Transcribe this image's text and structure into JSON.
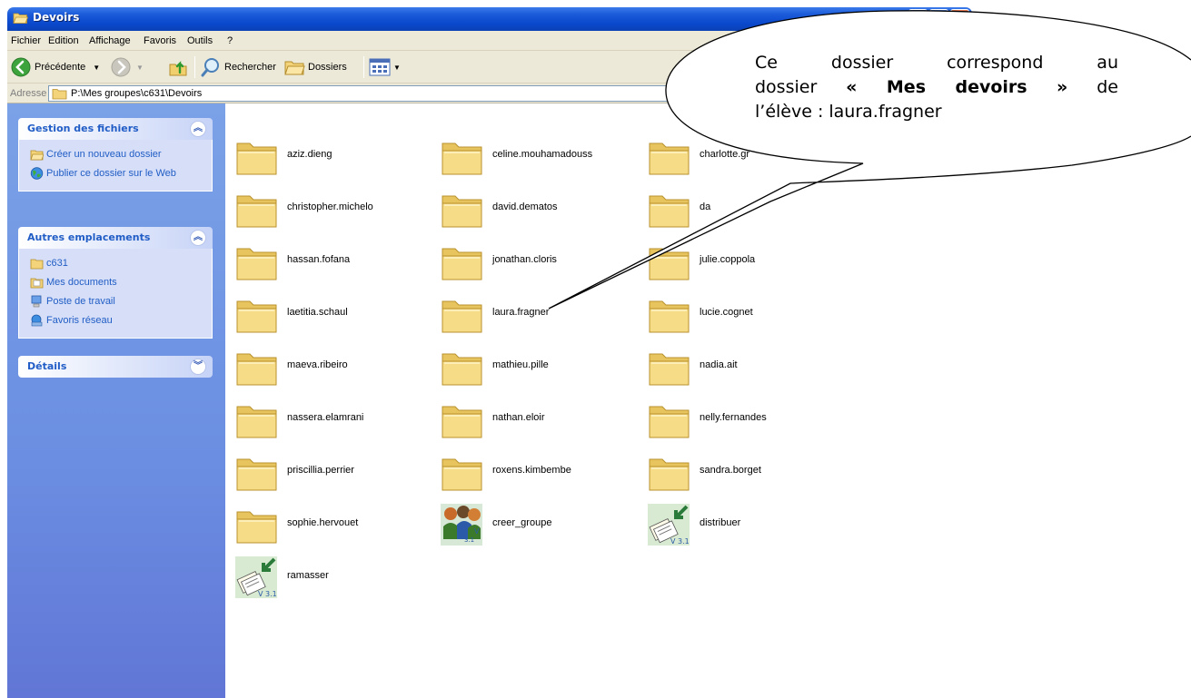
{
  "window": {
    "title": "Devoirs"
  },
  "menu": [
    "Fichier",
    "Edition",
    "Affichage",
    "Favoris",
    "Outils",
    "?"
  ],
  "toolbar": {
    "back_label": "Précédente",
    "search_label": "Rechercher",
    "folders_label": "Dossiers"
  },
  "address": {
    "label": "Adresse",
    "value": "P:\\Mes groupes\\c631\\Devoirs"
  },
  "sidebar": {
    "file_tasks": {
      "title": "Gestion des fichiers",
      "items": [
        "Créer un nouveau dossier",
        "Publier ce dossier sur le Web"
      ]
    },
    "other_places": {
      "title": "Autres emplacements",
      "items": [
        "c631",
        "Mes documents",
        "Poste de travail",
        "Favoris réseau"
      ]
    },
    "details": {
      "title": "Détails"
    }
  },
  "files": [
    {
      "name": "aziz.dieng",
      "type": "folder"
    },
    {
      "name": "celine.mouhamadouss",
      "type": "folder"
    },
    {
      "name": "charlotte.gr",
      "type": "folder"
    },
    {
      "name": "christopher.michelo",
      "type": "folder"
    },
    {
      "name": "david.dematos",
      "type": "folder"
    },
    {
      "name": "da",
      "type": "folder"
    },
    {
      "name": "hassan.fofana",
      "type": "folder"
    },
    {
      "name": "jonathan.cloris",
      "type": "folder"
    },
    {
      "name": "julie.coppola",
      "type": "folder"
    },
    {
      "name": "laetitia.schaul",
      "type": "folder"
    },
    {
      "name": "laura.fragner",
      "type": "folder"
    },
    {
      "name": "lucie.cognet",
      "type": "folder"
    },
    {
      "name": "maeva.ribeiro",
      "type": "folder"
    },
    {
      "name": "mathieu.pille",
      "type": "folder"
    },
    {
      "name": "nadia.ait",
      "type": "folder"
    },
    {
      "name": "nassera.elamrani",
      "type": "folder"
    },
    {
      "name": "nathan.eloir",
      "type": "folder"
    },
    {
      "name": "nelly.fernandes",
      "type": "folder"
    },
    {
      "name": "priscillia.perrier",
      "type": "folder"
    },
    {
      "name": "roxens.kimbembe",
      "type": "folder"
    },
    {
      "name": "sandra.borget",
      "type": "folder"
    },
    {
      "name": "sophie.hervouet",
      "type": "folder"
    },
    {
      "name": "creer_groupe",
      "type": "app-group"
    },
    {
      "name": "distribuer",
      "type": "app-docs"
    },
    {
      "name": "ramasser",
      "type": "app-docs"
    }
  ],
  "version_badge": "V 3.1",
  "callout": {
    "line1": "Ce dossier correspond au",
    "line2_prefix": "dossier ",
    "line2_bold": "« Mes devoirs »",
    "line2_suffix": " de",
    "line3": "l’élève : laura.fragner"
  },
  "colors": {
    "titlebar": "#0a48cc",
    "sidepanel": "#6b8ee2",
    "panel_title": "#215dc6",
    "chrome": "#ece9d8",
    "folder": "#f5d77a"
  }
}
